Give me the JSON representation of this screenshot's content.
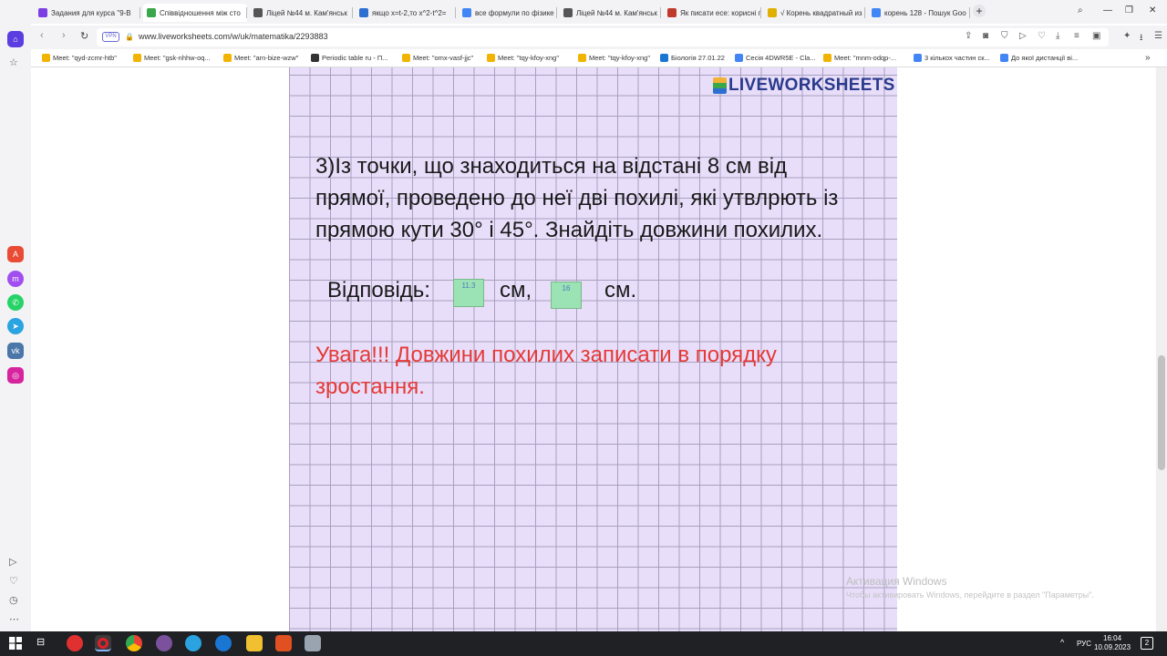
{
  "browser": {
    "tabs": [
      {
        "label": "Задания для курса \"9-В",
        "color": "#7b3fe4"
      },
      {
        "label": "Співвідношення між сто",
        "color": "#3aa74a",
        "active": true
      },
      {
        "label": "Ліцей №44 м. Кам'янськ",
        "color": "#555"
      },
      {
        "label": "якщо x=t-2,то x^2-t^2=",
        "color": "#2d6fd0"
      },
      {
        "label": "все формули по фізике",
        "color": "#4285f4"
      },
      {
        "label": "Ліцей №44 м. Кам'янськ",
        "color": "#555"
      },
      {
        "label": "Як писати есе: корисні п",
        "color": "#c0392b"
      },
      {
        "label": "√ Корень квадратный из",
        "color": "#e0b000"
      },
      {
        "label": "корень 128 - Пошук Goo",
        "color": "#4285f4"
      }
    ],
    "url": "www.liveworksheets.com/w/uk/matematika/2293883",
    "vpn": "VPN",
    "bookmarks": [
      "Meet: \"qyd-zcmr-htb\"",
      "Meet: \"gsk-nhhw-oq...",
      "Meet: \"arn-bize-wzw\"",
      "Periodic table ru - П...",
      "Meet: \"omx-vasf-jjc\"",
      "Meet: \"tqy-kfoy-xng\"",
      "Meet: \"tqy-kfoy-xng\"",
      "Біологія 27.01.22",
      "Сесія 4DWR5E - Cla...",
      "Meet: \"mnm-odqp-...",
      "3 кількох частин ск...",
      "До якої дистанції ві..."
    ]
  },
  "worksheet": {
    "logo": "LIVEWORKSHEETS",
    "question": "3)Із точки, що знаходиться на відстані 8 см від прямої, проведено до неї дві похилі, які утвлрють із прямою кути  30° і 45°. Знайдіть довжини похилих.",
    "answer_label": "Відповідь:",
    "answer1": "11.3",
    "unit1": "см,",
    "answer2": "16",
    "unit2": "см.",
    "warning": "Увага!!! Довжини похилих записати в порядку зростання."
  },
  "windows": {
    "activation_title": "Активация Windows",
    "activation_text": "Чтобы активировать Windows, перейдите в раздел \"Параметры\".",
    "lang": "РУС",
    "time": "16:04",
    "date": "10.09.2023",
    "notifications": "2"
  }
}
